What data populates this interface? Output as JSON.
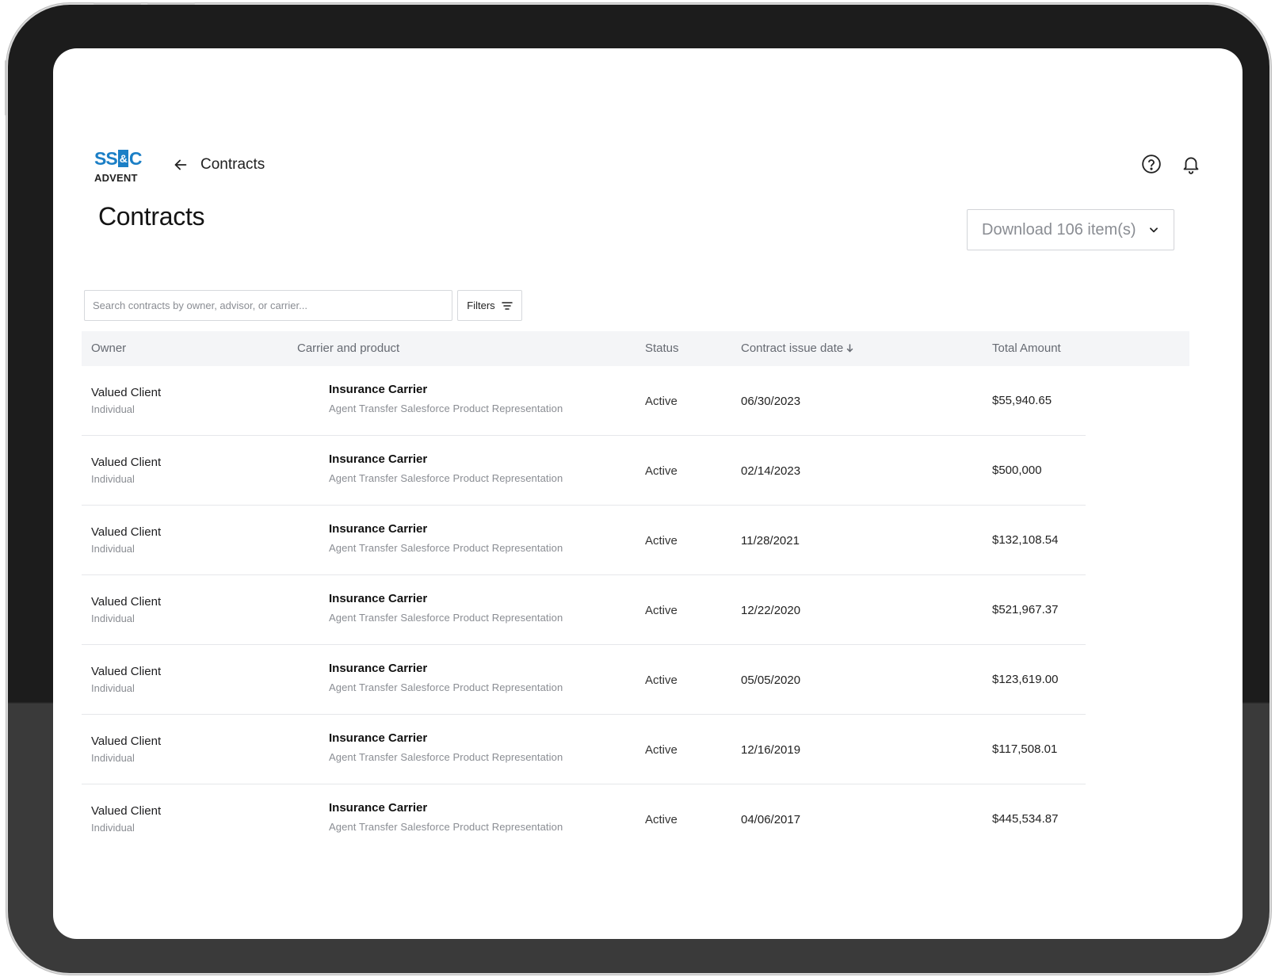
{
  "brand": {
    "logo_top_left": "SS",
    "logo_amp": "&",
    "logo_top_right": "C",
    "logo_bottom": "ADVENT"
  },
  "header": {
    "breadcrumb": "Contracts",
    "help_icon": "help-circle-icon",
    "notification_icon": "bell-icon"
  },
  "page": {
    "title": "Contracts",
    "download_label": "Download 106 item(s)"
  },
  "toolbar": {
    "search_placeholder": "Search contracts by owner, advisor, or carrier...",
    "filters_label": "Filters"
  },
  "table": {
    "columns": {
      "owner": "Owner",
      "carrier_product": "Carrier and product",
      "status": "Status",
      "issue_date": "Contract issue date",
      "total_amount": "Total Amount"
    },
    "rows": [
      {
        "owner": "Valued Client",
        "owner_type": "Individual",
        "carrier": "Insurance Carrier",
        "product": "Agent Transfer Salesforce Product Representation",
        "status": "Active",
        "date": "06/30/2023",
        "amount": "$55,940.65"
      },
      {
        "owner": "Valued Client",
        "owner_type": "Individual",
        "carrier": "Insurance Carrier",
        "product": "Agent Transfer Salesforce Product Representation",
        "status": "Active",
        "date": "02/14/2023",
        "amount": "$500,000"
      },
      {
        "owner": "Valued Client",
        "owner_type": "Individual",
        "carrier": "Insurance Carrier",
        "product": "Agent Transfer Salesforce Product Representation",
        "status": "Active",
        "date": "11/28/2021",
        "amount": "$132,108.54"
      },
      {
        "owner": "Valued Client",
        "owner_type": "Individual",
        "carrier": "Insurance Carrier",
        "product": "Agent Transfer Salesforce Product Representation",
        "status": "Active",
        "date": "12/22/2020",
        "amount": "$521,967.37"
      },
      {
        "owner": "Valued Client",
        "owner_type": "Individual",
        "carrier": "Insurance Carrier",
        "product": "Agent Transfer Salesforce Product Representation",
        "status": "Active",
        "date": "05/05/2020",
        "amount": "$123,619.00"
      },
      {
        "owner": "Valued Client",
        "owner_type": "Individual",
        "carrier": "Insurance Carrier",
        "product": "Agent Transfer Salesforce Product Representation",
        "status": "Active",
        "date": "12/16/2019",
        "amount": "$117,508.01"
      },
      {
        "owner": "Valued Client",
        "owner_type": "Individual",
        "carrier": "Insurance Carrier",
        "product": "Agent Transfer Salesforce Product Representation",
        "status": "Active",
        "date": "04/06/2017",
        "amount": "$445,534.87"
      }
    ]
  },
  "colors": {
    "brand_blue": "#1b7fc6",
    "header_bg": "#f4f5f7",
    "device_frame": "#1c1c1c"
  }
}
